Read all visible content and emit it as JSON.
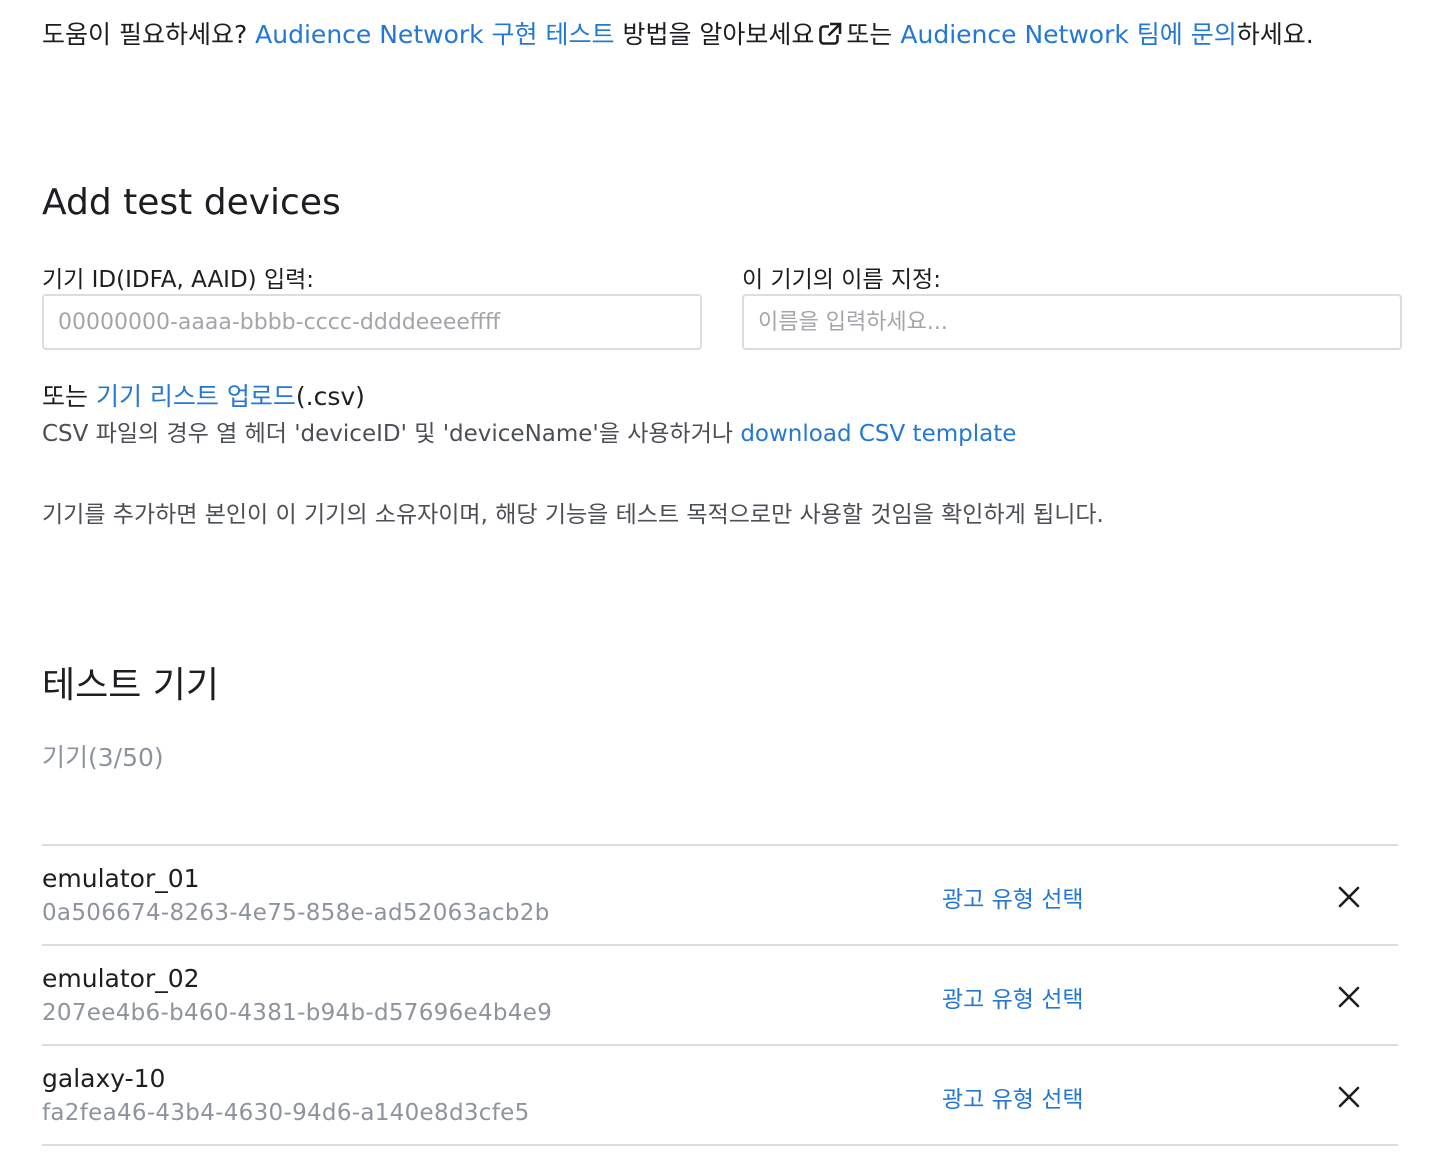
{
  "help": {
    "prefix": "도움이 필요하세요?",
    "link1": "Audience Network 구현 테스트",
    "middle": "방법을 알아보세요",
    "conj": "또는",
    "link2": "Audience Network 팀에 문의",
    "suffix": "하세요.",
    "external_icon": "external-link-icon"
  },
  "add_section": {
    "title": "Add test devices",
    "id_label": "기기 ID(IDFA, AAID) 입력:",
    "id_placeholder": "00000000-aaaa-bbbb-cccc-ddddeeeeffff",
    "name_label": "이 기기의 이름 지정:",
    "name_placeholder": "이름을 입력하세요...",
    "upload_prefix": "또는",
    "upload_link": "기기 리스트 업로드",
    "upload_suffix": "(.csv)",
    "csv_note": "CSV 파일의 경우 열 헤더 'deviceID' 및 'deviceName'을 사용하거나",
    "csv_template_link": "download CSV template",
    "consent": "기기를 추가하면 본인이 이 기기의 소유자이며, 해당 기능을 테스트 목적으로만 사용할 것임을 확인하게 됩니다."
  },
  "test_devices": {
    "title": "테스트 기기",
    "count": "기기(3/50)",
    "ad_type_label": "광고 유형 선택",
    "remove_icon": "close-icon",
    "devices": [
      {
        "name": "emulator_01",
        "id": "0a506674-8263-4e75-858e-ad52063acb2b"
      },
      {
        "name": "emulator_02",
        "id": "207ee4b6-b460-4381-b94b-d57696e4b4e9"
      },
      {
        "name": "galaxy-10",
        "id": "fa2fea46-43b4-4630-94d6-a140e8d3cfe5"
      }
    ]
  },
  "colors": {
    "link": "#2478d4",
    "text": "#1c1e21",
    "muted": "#8d949e",
    "border": "#dadde1"
  }
}
